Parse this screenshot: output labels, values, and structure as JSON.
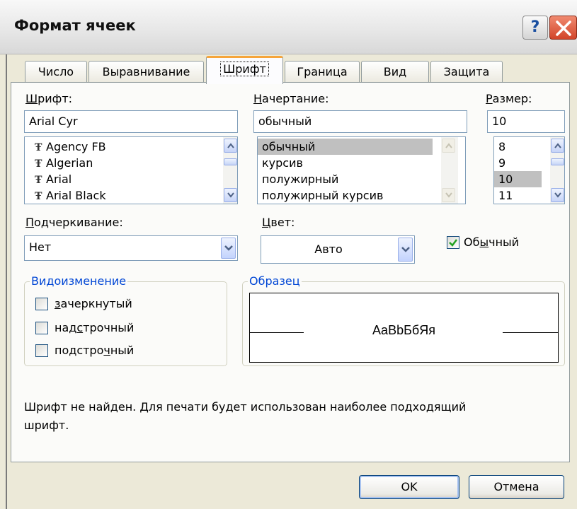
{
  "window": {
    "title": "Формат ячеек",
    "help_glyph": "?"
  },
  "tabs": [
    {
      "label": "Число"
    },
    {
      "label": "Выравнивание"
    },
    {
      "label": "Шрифт",
      "selected": true
    },
    {
      "label": "Граница"
    },
    {
      "label": "Вид"
    },
    {
      "label": "Защита"
    }
  ],
  "font": {
    "label_u": "Ш",
    "label_rest": "рифт:",
    "value": "Arial Cyr",
    "icon_glyph": "Ŧ",
    "list": [
      "Agency FB",
      "Algerian",
      "Arial",
      "Arial Black"
    ]
  },
  "style": {
    "label_u": "Н",
    "label_rest": "ачертание:",
    "value": "обычный",
    "list": [
      "обычный",
      "курсив",
      "полужирный",
      "полужирный курсив"
    ],
    "selected_index": 0
  },
  "size": {
    "label_u": "Р",
    "label_rest": "азмер:",
    "value": "10",
    "list": [
      "8",
      "9",
      "10",
      "11"
    ],
    "selected_index": 2
  },
  "underline": {
    "label_u": "П",
    "label_rest": "одчеркивание:",
    "value": "Нет"
  },
  "color": {
    "label_u": "Ц",
    "label_rest": "вет:",
    "value": "Авто"
  },
  "normal_font": {
    "label_pre": "Об",
    "label_u": "ы",
    "label_rest": "чный",
    "checked": true
  },
  "effects": {
    "legend": "Видоизменение",
    "items": [
      {
        "pre": "",
        "u": "з",
        "rest": "ачеркнутый",
        "checked": false
      },
      {
        "pre": "над",
        "u": "с",
        "rest": "трочный",
        "checked": false
      },
      {
        "pre": "подстро",
        "u": "ч",
        "rest": "ный",
        "checked": false
      }
    ]
  },
  "preview": {
    "legend": "Образец",
    "sample": "AaBbБбЯя"
  },
  "message": {
    "line1": "Шрифт не найден. Для печати будет использован наиболее подходящий",
    "line2": "шрифт."
  },
  "buttons": {
    "ok": "OK",
    "cancel": "Отмена"
  },
  "colors": {
    "accent": "#0046d5",
    "tab_highlight": "#f6a53b",
    "checkmark": "#21a121",
    "close_red": "#d2452a"
  }
}
